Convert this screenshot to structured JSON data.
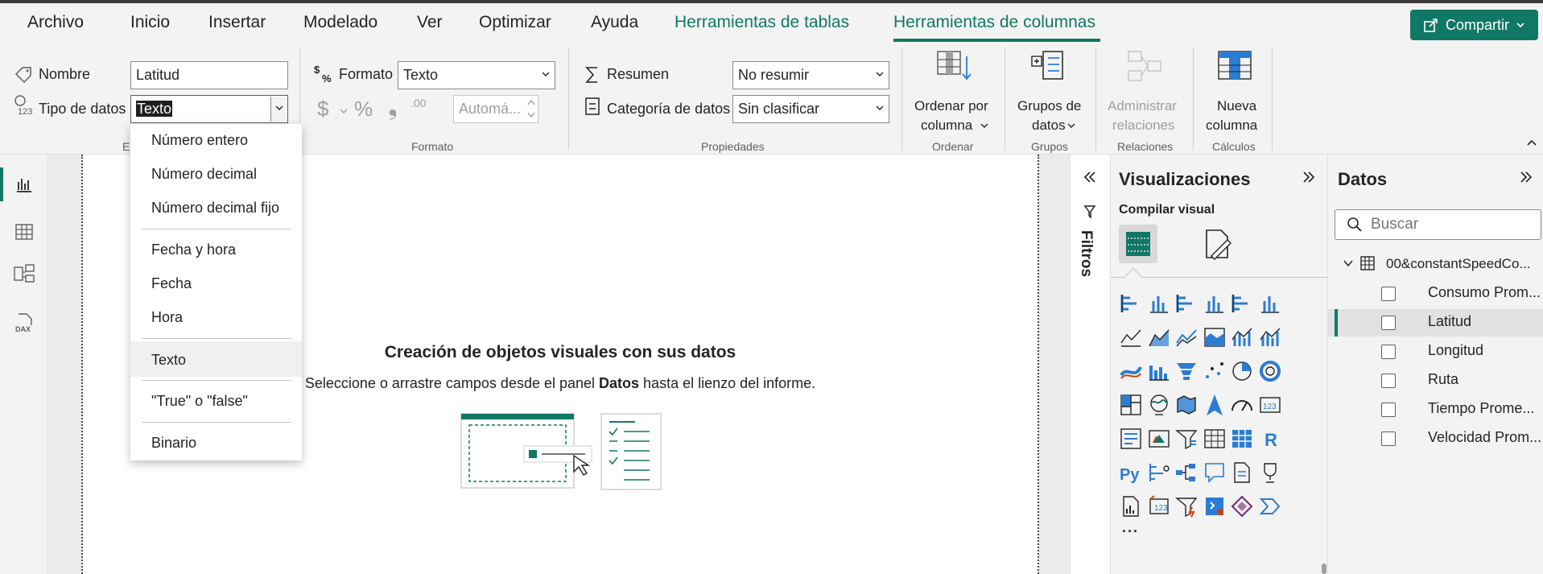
{
  "menu": {
    "items": [
      "Archivo",
      "Inicio",
      "Insertar",
      "Modelado",
      "Ver",
      "Optimizar",
      "Ayuda"
    ],
    "context_tabs": [
      "Herramientas de tablas",
      "Herramientas de columnas"
    ],
    "share_label": "Compartir"
  },
  "ribbon": {
    "name_label": "Nombre",
    "name_value": "Latitud",
    "datatype_label": "Tipo de datos",
    "datatype_value": "Texto",
    "structure_group_partial": "Es",
    "format_label": "Formato",
    "format_value": "Texto",
    "currency_symbol": "$",
    "percent_symbol": "%",
    "comma_symbol": "❟",
    "decimal_symbol": ".00",
    "auto_placeholder": "Automá...",
    "format_group": "Formato",
    "summary_label": "Resumen",
    "summary_value": "No resumir",
    "category_label": "Categoría de datos",
    "category_value": "Sin clasificar",
    "properties_group": "Propiedades",
    "sort_line1": "Ordenar por",
    "sort_line2": "columna",
    "sort_group": "Ordenar",
    "groups_line1": "Grupos de",
    "groups_line2": "datos",
    "groups_group": "Grupos",
    "rel_line1": "Administrar",
    "rel_line2": "relaciones",
    "rel_group": "Relaciones",
    "newcol_line1": "Nueva",
    "newcol_line2": "columna",
    "calc_group": "Cálculos"
  },
  "dropdown": {
    "items": [
      "Número entero",
      "Número decimal",
      "Número decimal fijo",
      "Fecha y hora",
      "Fecha",
      "Hora",
      "Texto",
      "\"True\" o \"false\"",
      "Binario"
    ],
    "selected": "Texto"
  },
  "canvas": {
    "title": "Creación de objetos visuales con sus datos",
    "subtitle_prefix": "Seleccione o arrastre campos desde el panel ",
    "subtitle_bold": "Datos",
    "subtitle_suffix": " hasta el lienzo del informe."
  },
  "filters": {
    "label": "Filtros"
  },
  "visualizations": {
    "title": "Visualizaciones",
    "build_label": "Compilar visual",
    "more": "···",
    "r_label": "R",
    "py_label": "Py"
  },
  "data_pane": {
    "title": "Datos",
    "search_placeholder": "Buscar",
    "table_name": "00&constantSpeedCo...",
    "fields": [
      "Consumo Prom...",
      "Latitud",
      "Longitud",
      "Ruta",
      "Tiempo Prome...",
      "Velocidad Prom..."
    ],
    "selected_field": "Latitud"
  },
  "colors": {
    "accent": "#117865",
    "icon_blue": "#2b7cd3"
  }
}
